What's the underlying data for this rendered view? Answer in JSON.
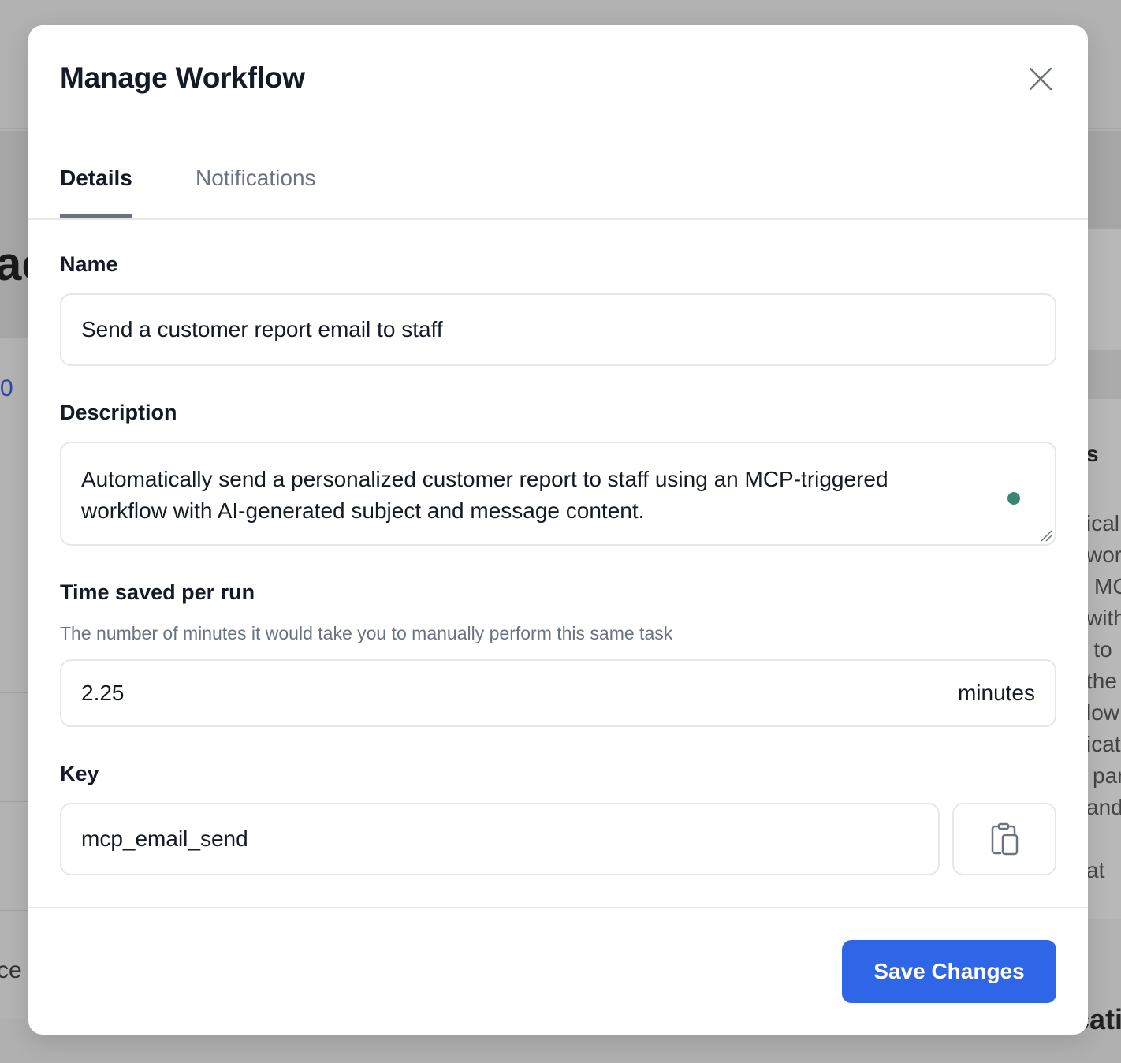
{
  "background": {
    "title_fragment": "ac",
    "number_fragment": "0",
    "side_text_lines": [
      "s",
      "ical",
      "wor",
      "MC",
      "with",
      "e to",
      "the",
      "low",
      "icat",
      "par",
      "and",
      "at"
    ],
    "bottom_left_fragment": "ce t",
    "bottom_right_fragment": "cati"
  },
  "modal": {
    "title": "Manage Workflow",
    "close_icon": "close-icon",
    "tabs": [
      {
        "label": "Details",
        "active": true
      },
      {
        "label": "Notifications",
        "active": false
      }
    ],
    "name": {
      "label": "Name",
      "value": "Send a customer report email to staff"
    },
    "description": {
      "label": "Description",
      "value": "Automatically send a personalized customer report to staff using an MCP-triggered workflow with AI-generated subject and message content."
    },
    "time_saved": {
      "label": "Time saved per run",
      "hint": "The number of minutes it would take you to manually perform this same task",
      "value": "2.25",
      "unit": "minutes"
    },
    "key": {
      "label": "Key",
      "value": "mcp_email_send",
      "copy_icon": "clipboard-copy-icon"
    },
    "save_label": "Save Changes"
  },
  "colors": {
    "primary": "#2f66e8",
    "status_dot": "#3a8573",
    "overlay": "#b3b3b3"
  }
}
